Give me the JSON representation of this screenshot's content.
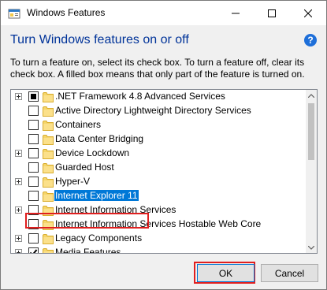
{
  "window": {
    "title": "Windows Features",
    "icon": "windows-features-icon"
  },
  "dialog": {
    "heading": "Turn Windows features on or off",
    "description": "To turn a feature on, select its check box. To turn a feature off, clear its check box. A filled box means that only part of the feature is turned on.",
    "help_icon": "?"
  },
  "features": [
    {
      "label": ".NET Framework 4.8 Advanced Services",
      "expandable": true,
      "state": "partial",
      "selected": false
    },
    {
      "label": "Active Directory Lightweight Directory Services",
      "expandable": false,
      "state": "unchecked",
      "selected": false
    },
    {
      "label": "Containers",
      "expandable": false,
      "state": "unchecked",
      "selected": false
    },
    {
      "label": "Data Center Bridging",
      "expandable": false,
      "state": "unchecked",
      "selected": false
    },
    {
      "label": "Device Lockdown",
      "expandable": true,
      "state": "unchecked",
      "selected": false
    },
    {
      "label": "Guarded Host",
      "expandable": false,
      "state": "unchecked",
      "selected": false
    },
    {
      "label": "Hyper-V",
      "expandable": true,
      "state": "unchecked",
      "selected": false
    },
    {
      "label": "Internet Explorer 11",
      "expandable": false,
      "state": "unchecked",
      "selected": true
    },
    {
      "label": "Internet Information Services",
      "expandable": true,
      "state": "unchecked",
      "selected": false
    },
    {
      "label": "Internet Information Services Hostable Web Core",
      "expandable": false,
      "state": "unchecked",
      "selected": false
    },
    {
      "label": "Legacy Components",
      "expandable": true,
      "state": "unchecked",
      "selected": false
    },
    {
      "label": "Media Features",
      "expandable": true,
      "state": "checked",
      "selected": false
    }
  ],
  "buttons": {
    "ok": "OK",
    "cancel": "Cancel"
  },
  "colors": {
    "heading": "#003399",
    "selection": "#0078d7",
    "annotation": "#e01f1f"
  }
}
